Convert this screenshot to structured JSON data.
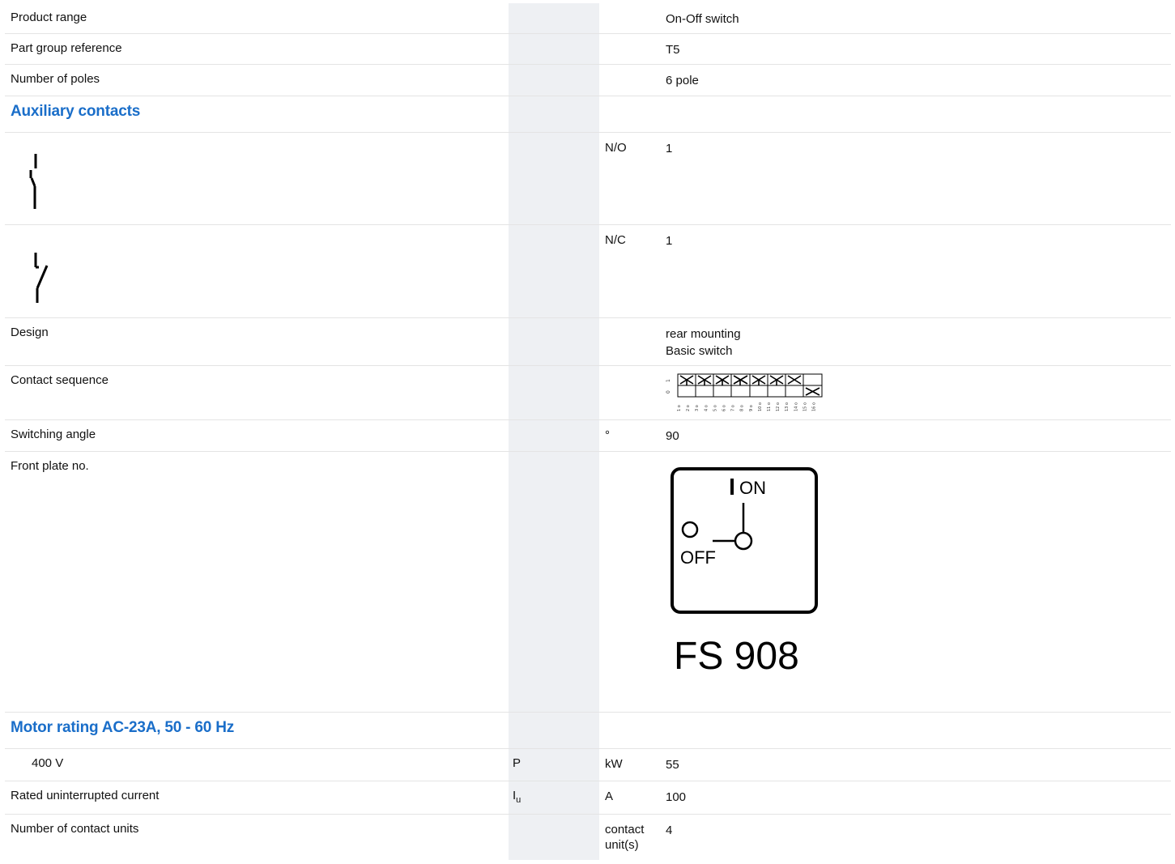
{
  "rows": {
    "product_range": {
      "label": "Product range",
      "value": "On-Off switch"
    },
    "part_group": {
      "label": "Part group reference",
      "value": "T5"
    },
    "poles": {
      "label": "Number of poles",
      "value": "6 pole"
    },
    "aux_section": {
      "label": "Auxiliary contacts"
    },
    "no_contact": {
      "symbol_icon": "normally-open-contact-symbol",
      "unit": "N/O",
      "value": "1"
    },
    "nc_contact": {
      "symbol_icon": "normally-closed-contact-symbol",
      "unit": "N/C",
      "value": "1"
    },
    "design": {
      "label": "Design",
      "value_line1": "rear mounting",
      "value_line2": "Basic switch"
    },
    "contact_sequence": {
      "label": "Contact sequence",
      "diagram_icon": "contact-sequence-diagram",
      "positions": [
        "0",
        "1"
      ],
      "terminals": [
        "1",
        "2",
        "3",
        "4",
        "5",
        "6",
        "7",
        "8",
        "9",
        "10",
        "11",
        "12",
        "13",
        "14",
        "15",
        "16"
      ]
    },
    "switching_angle": {
      "label": "Switching angle",
      "unit": "°",
      "value": "90"
    },
    "front_plate": {
      "label": "Front plate no.",
      "on_text": "ON",
      "off_text": "OFF",
      "plate_code": "FS 908"
    },
    "motor_section": {
      "label": "Motor rating AC-23A, 50 - 60 Hz"
    },
    "voltage_400": {
      "label": "400 V",
      "symbol": "P",
      "unit": "kW",
      "value": "55"
    },
    "rated_current": {
      "label": "Rated uninterrupted current",
      "symbol": "I",
      "symbol_sub": "u",
      "unit": "A",
      "value": "100"
    },
    "contact_units": {
      "label": "Number of contact units",
      "unit_line1": "contact",
      "unit_line2": "unit(s)",
      "value": "4"
    }
  },
  "colors": {
    "section_heading": "#1a6ec9",
    "symbol_column": "#eef0f3",
    "divider": "#e4e4e4"
  }
}
